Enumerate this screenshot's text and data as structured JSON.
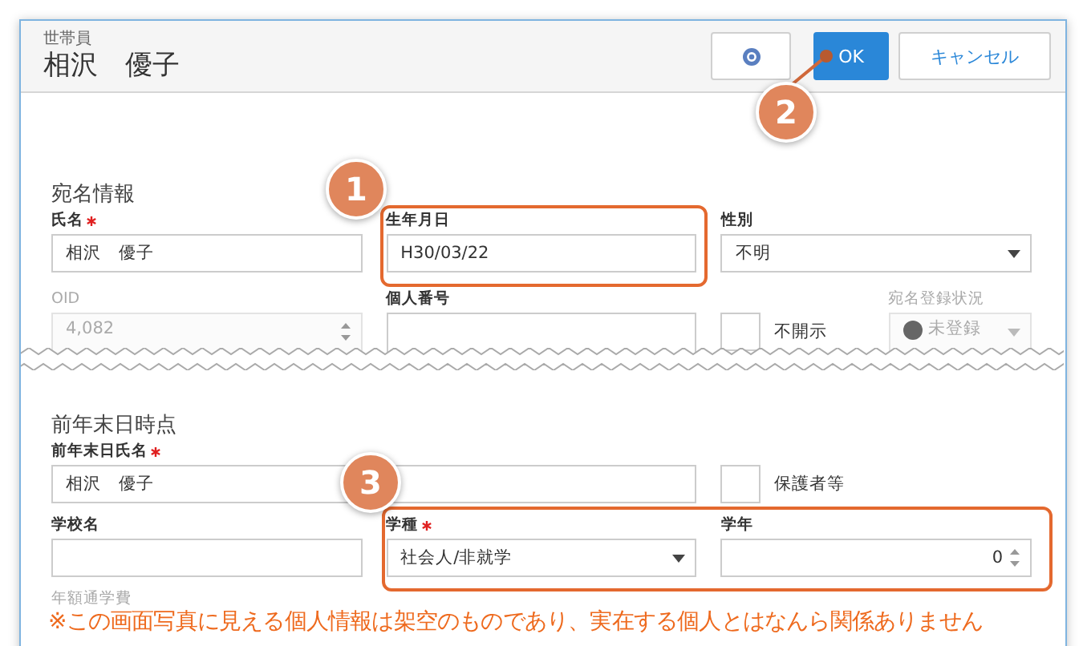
{
  "header": {
    "caption": "世帯員",
    "name": "相沢　優子",
    "buttons": [
      {
        "kind": "help"
      },
      {
        "kind": "primary",
        "label": "OK"
      },
      {
        "kind": "secondary",
        "label": "キャンセル"
      }
    ]
  },
  "sections": [
    {
      "title": "宛名情報",
      "torn": true,
      "rows": [
        [
          {
            "kind": "text",
            "label": "氏名",
            "required": true,
            "value": "相沢　優子",
            "disabled": false
          },
          {
            "kind": "text",
            "label": "生年月日",
            "required": false,
            "value": "H30/03/22",
            "disabled": false
          },
          {
            "kind": "select",
            "label": "性別",
            "required": false,
            "value": "不明",
            "disabled": false
          }
        ],
        [
          {
            "kind": "number",
            "label": "OID",
            "required": false,
            "value": "4,082",
            "disabled": true
          },
          {
            "kind": "text",
            "label": "個人番号",
            "required": false,
            "disabled": false
          },
          {
            "kind": "checkbox",
            "text": "不開示",
            "checked": false,
            "disabled": false
          },
          {
            "kind": "status-select",
            "label": "宛名登録状況",
            "required": false,
            "value": "未登録",
            "disabled": true
          }
        ]
      ]
    },
    {
      "title": "前年末日時点",
      "torn": false,
      "rows": [
        [
          {
            "kind": "text",
            "label": "前年末日氏名",
            "required": true,
            "value": "相沢　優子",
            "disabled": false
          },
          "",
          {
            "kind": "checkbox",
            "text": "保護者等",
            "checked": false,
            "disabled": false
          }
        ],
        [
          {
            "kind": "text",
            "label": "学校名",
            "required": false,
            "disabled": false
          },
          {
            "kind": "select",
            "label": "学種",
            "required": true,
            "value": "社会人/非就学",
            "disabled": false
          },
          {
            "kind": "number",
            "label": "学年",
            "required": false,
            "value": "0",
            "disabled": false
          }
        ],
        [
          {
            "kind": "label-only",
            "label": "年額通学費",
            "disabled": true
          }
        ]
      ]
    }
  ],
  "annotations": {
    "callouts": [
      "1",
      "2",
      "3"
    ],
    "disclaimer": "※この画面写真に見える個人情報は架空のものであり、実在する個人とはなんら関係ありません"
  }
}
